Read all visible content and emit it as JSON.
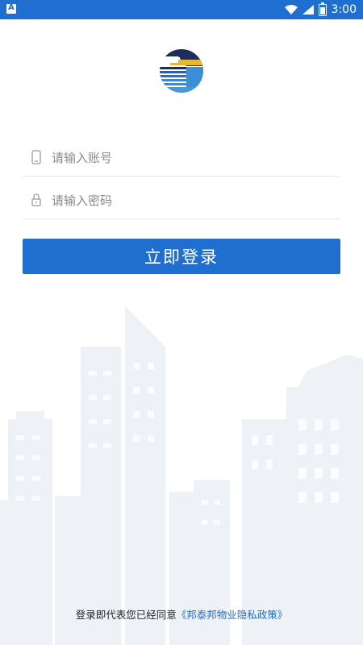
{
  "status_bar": {
    "time": "3:00",
    "left_icon": "app-notification-icon",
    "right_icons": [
      "wifi-icon",
      "signal-icon",
      "battery-icon"
    ]
  },
  "logo": {
    "icon": "building-logo"
  },
  "form": {
    "account_placeholder": "请输入账号",
    "password_placeholder": "请输入密码",
    "account_icon": "phone-icon",
    "password_icon": "lock-icon",
    "submit_label": "立即登录"
  },
  "agreement": {
    "prefix": "登录即代表您已经同意",
    "policy_link": "《邦泰邦物业隐私政策》"
  },
  "colors": {
    "primary": "#1f6fd1",
    "placeholder": "#8a8a8a",
    "divider": "#e8e8e8",
    "background_art": "#eef1f6"
  }
}
